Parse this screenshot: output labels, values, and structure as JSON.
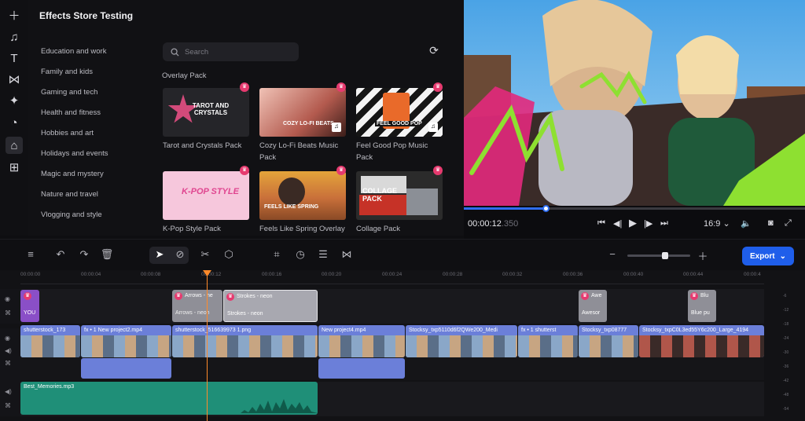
{
  "rail": {
    "icons": [
      "plus-icon",
      "music-note-icon",
      "text-icon",
      "transition-icon",
      "effects-wand-icon",
      "sticker-icon",
      "effects-store-icon",
      "templates-icon"
    ]
  },
  "library": {
    "title": "Effects Store Testing",
    "categories": [
      "Education and work",
      "Family and kids",
      "Gaming and tech",
      "Health and fitness",
      "Hobbies and art",
      "Holidays and events",
      "Magic and mystery",
      "Nature and travel",
      "Vlogging and style"
    ],
    "search_placeholder": "Search",
    "section": "Overlay Pack",
    "packs": [
      {
        "name": "Tarot and Crystals Pack",
        "thumb_text": "TAROT AND CRYSTALS"
      },
      {
        "name": "Cozy Lo-Fi Beats Music Pack",
        "thumb_text": "COZY LO-FI BEATS"
      },
      {
        "name": "Feel Good Pop Music Pack",
        "thumb_text": "FEEL GOOD POP"
      },
      {
        "name": "K-Pop Style Pack",
        "thumb_text": "K-POP STYLE"
      },
      {
        "name": "Feels Like Spring Overlay",
        "thumb_text": "FEELS LIKE SPRING"
      },
      {
        "name": "Collage Pack",
        "thumb_text": "COLLAGE PACK"
      }
    ]
  },
  "player": {
    "time_main": "00:00:12",
    "time_frac": ".350",
    "aspect": "16:9",
    "progress": 0.24
  },
  "toolbar": {
    "export_label": "Export"
  },
  "timeline": {
    "ticks": [
      "00:00:00",
      "00:00:04",
      "00:00:08",
      "00:00:12",
      "00:00:16",
      "00:00:20",
      "00:00:24",
      "00:00:28",
      "00:00:32",
      "00:00:36",
      "00:00:40",
      "00:00:44",
      "00:00:4"
    ],
    "overlay_clips": [
      {
        "title": "",
        "sub": "YOU"
      },
      {
        "title": "Arrows - ne",
        "sub": "Arrows - neon"
      },
      {
        "title": "Strokes - neon",
        "sub": "Strokes - neon"
      },
      {
        "title": "Awe",
        "sub": "Awesor"
      },
      {
        "title": "Blu",
        "sub": "Blue pu"
      }
    ],
    "video_clips": [
      {
        "label": "shutterstock_173"
      },
      {
        "label": "fx • 1   New project2.mp4"
      },
      {
        "label": "shutterstock_516639973 1.png"
      },
      {
        "label": "New project4.mp4"
      },
      {
        "label": "Stocksy_txp5110d6f2QWe200_Medi"
      },
      {
        "label": "fx • 1   shutterst"
      },
      {
        "label": "Stocksy_txp08777"
      },
      {
        "label": "Stocksy_txpC0L3ed55Y6c200_Large_4194"
      }
    ],
    "audio_clip": {
      "label": "Best_Memories.mp3"
    },
    "meter_labels": [
      "-6",
      "-12",
      "-18",
      "-24",
      "-30",
      "-36",
      "-42",
      "-48",
      "-54"
    ]
  },
  "colors": {
    "accent": "#1f5eea",
    "crown": "#e63a6f",
    "playhead": "#ff8a2a",
    "video_clip": "#6b7fd9",
    "audio_clip": "#2aa88f"
  }
}
